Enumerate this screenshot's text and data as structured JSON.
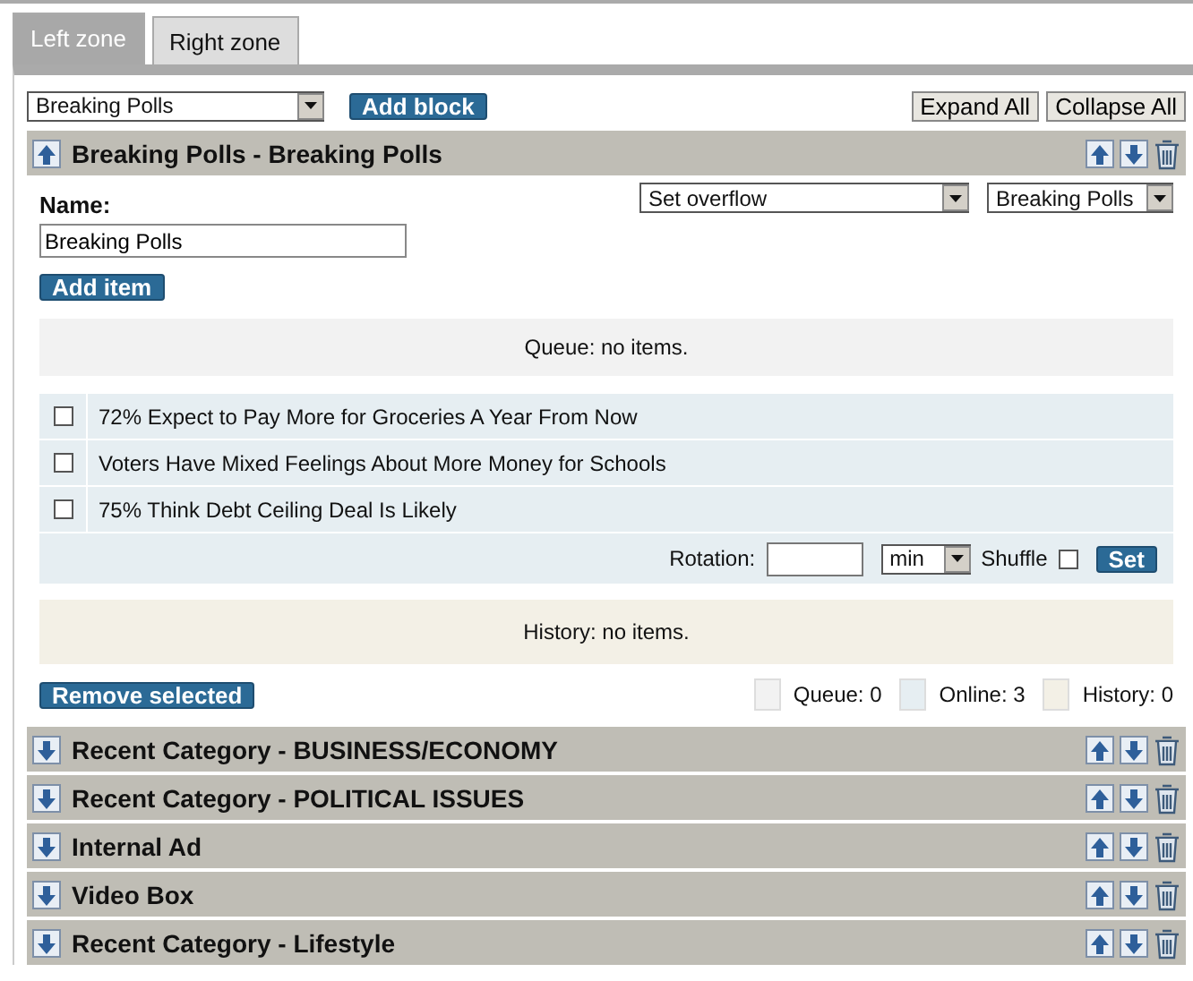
{
  "tabs": [
    {
      "label": "Left zone",
      "selected": true
    },
    {
      "label": "Right zone",
      "selected": false
    }
  ],
  "toolbar": {
    "block_select": "Breaking Polls",
    "add_button": "Add block",
    "expand_button": "Expand All",
    "collapse_button": "Collapse All"
  },
  "blocks": [
    {
      "title": "Breaking Polls - Breaking Polls",
      "expanded": true,
      "name_label": "Name:",
      "name_value": "Breaking Polls",
      "overflow_select": "Set overflow",
      "target_select": "Breaking Polls",
      "add_item_button": "Add item",
      "queue_text": "Queue: no items.",
      "items": [
        {
          "title": "72% Expect to Pay More for Groceries A Year From Now",
          "checked": false
        },
        {
          "title": "Voters Have Mixed Feelings About More Money for Schools",
          "checked": false
        },
        {
          "title": "75% Think Debt Ceiling Deal Is Likely",
          "checked": false
        }
      ],
      "rotation_label": "Rotation:",
      "rotation_unit": "min",
      "shuffle_label": "Shuffle",
      "shuffle_checked": false,
      "set_button": "Set",
      "history_text": "History: no items.",
      "remove_button": "Remove selected",
      "legend": [
        {
          "label": "Queue: 0",
          "color": "#f2f2f2"
        },
        {
          "label": "Online: 3",
          "color": "#e6eef2"
        },
        {
          "label": "History: 0",
          "color": "#f3f0e6"
        }
      ]
    },
    {
      "title": "Recent Category - BUSINESS/ECONOMY",
      "expanded": false
    },
    {
      "title": "Recent Category - POLITICAL ISSUES",
      "expanded": false
    },
    {
      "title": "Internal Ad",
      "expanded": false
    },
    {
      "title": "Video Box",
      "expanded": false
    },
    {
      "title": "Recent Category - Lifestyle",
      "expanded": false
    }
  ]
}
